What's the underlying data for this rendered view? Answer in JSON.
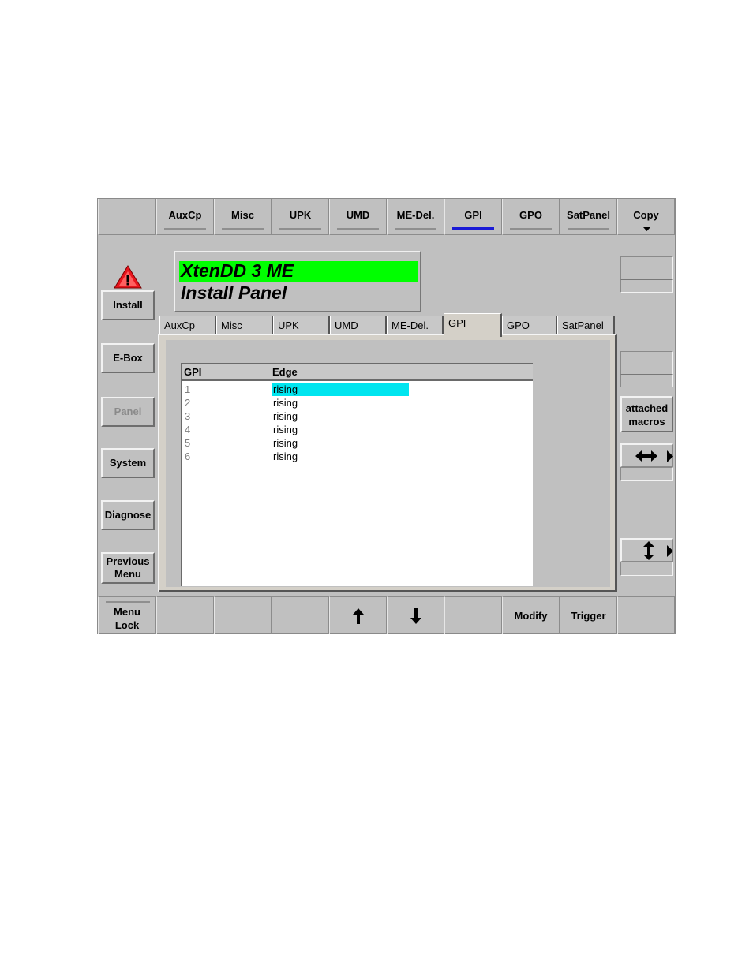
{
  "top_tabs": [
    {
      "label": ""
    },
    {
      "label": "AuxCp"
    },
    {
      "label": "Misc"
    },
    {
      "label": "UPK"
    },
    {
      "label": "UMD"
    },
    {
      "label": "ME-Del."
    },
    {
      "label": "GPI"
    },
    {
      "label": "GPO"
    },
    {
      "label": "SatPanel"
    },
    {
      "label": "Copy"
    }
  ],
  "top_active": "GPI",
  "header": {
    "product": "XtenDD 3 ME",
    "title": "Install Panel"
  },
  "left_menu": [
    {
      "label": "Install"
    },
    {
      "label": "E-Box"
    },
    {
      "label": "Panel"
    },
    {
      "label": "System"
    },
    {
      "label": "Diagnose"
    },
    {
      "label": "Previous Menu"
    }
  ],
  "inner_tabs": [
    {
      "label": "AuxCp"
    },
    {
      "label": "Misc"
    },
    {
      "label": "UPK"
    },
    {
      "label": "UMD"
    },
    {
      "label": "ME-Del."
    },
    {
      "label": "GPI"
    },
    {
      "label": "GPO"
    },
    {
      "label": "SatPanel"
    }
  ],
  "table": {
    "columns": [
      "GPI",
      "Edge"
    ],
    "rows": [
      {
        "gpi": "1",
        "edge": "rising",
        "selected": true
      },
      {
        "gpi": "2",
        "edge": "rising"
      },
      {
        "gpi": "3",
        "edge": "rising"
      },
      {
        "gpi": "4",
        "edge": "rising"
      },
      {
        "gpi": "5",
        "edge": "rising"
      },
      {
        "gpi": "6",
        "edge": "rising"
      }
    ]
  },
  "right_panel": {
    "attached_macros": "attached macros"
  },
  "bottom_bar": [
    {
      "label": "Menu Lock"
    },
    {
      "label": ""
    },
    {
      "label": ""
    },
    {
      "label": ""
    },
    {
      "icon": "arrow-up-icon"
    },
    {
      "icon": "arrow-down-icon"
    },
    {
      "label": ""
    },
    {
      "label": "Modify"
    },
    {
      "label": "Trigger"
    },
    {
      "label": ""
    }
  ],
  "colors": {
    "panel_bg": "#c0c0c0",
    "header_green": "#00ff00",
    "selection_cyan": "#00e5ef",
    "active_tab_line": "#1a1ad6",
    "warning_red": "#e8141c"
  }
}
